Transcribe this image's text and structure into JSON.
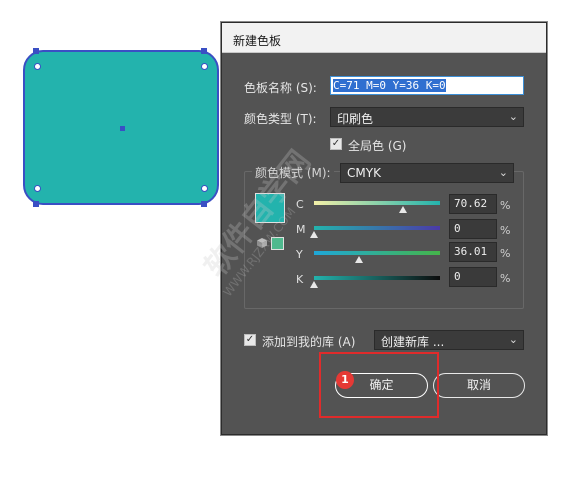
{
  "dialog": {
    "title": "新建色板",
    "swatch_name_label": "色板名称 (S):",
    "swatch_name_value": "C=71 M=0 Y=36 K=0",
    "color_type_label": "颜色类型 (T):",
    "color_type_value": "印刷色",
    "global_label": "全局色 (G)",
    "global_checked": true,
    "color_mode_label": "颜色模式 (M):",
    "color_mode_value": "CMYK",
    "channels": [
      {
        "name": "C",
        "value": "70.62",
        "fraction": 0.7062,
        "unit": "%"
      },
      {
        "name": "M",
        "value": "0",
        "fraction": 0.0,
        "unit": "%"
      },
      {
        "name": "Y",
        "value": "36.01",
        "fraction": 0.3601,
        "unit": "%"
      },
      {
        "name": "K",
        "value": "0",
        "fraction": 0.0,
        "unit": "%"
      }
    ],
    "add_to_library_label": "添加到我的库 (A)",
    "add_to_library_checked": true,
    "library_value": "创建新库 ...",
    "ok_label": "确定",
    "cancel_label": "取消"
  },
  "annotation": {
    "step_number": "1",
    "highlight_color": "#e02b2b"
  },
  "colors": {
    "swatch": "#23b3ad",
    "gamut_swatch": "#4fb98e",
    "selection": "#3a4fc4"
  },
  "watermark": {
    "text": "软件自学网",
    "sub": "WWW.RJZXW.COM"
  }
}
